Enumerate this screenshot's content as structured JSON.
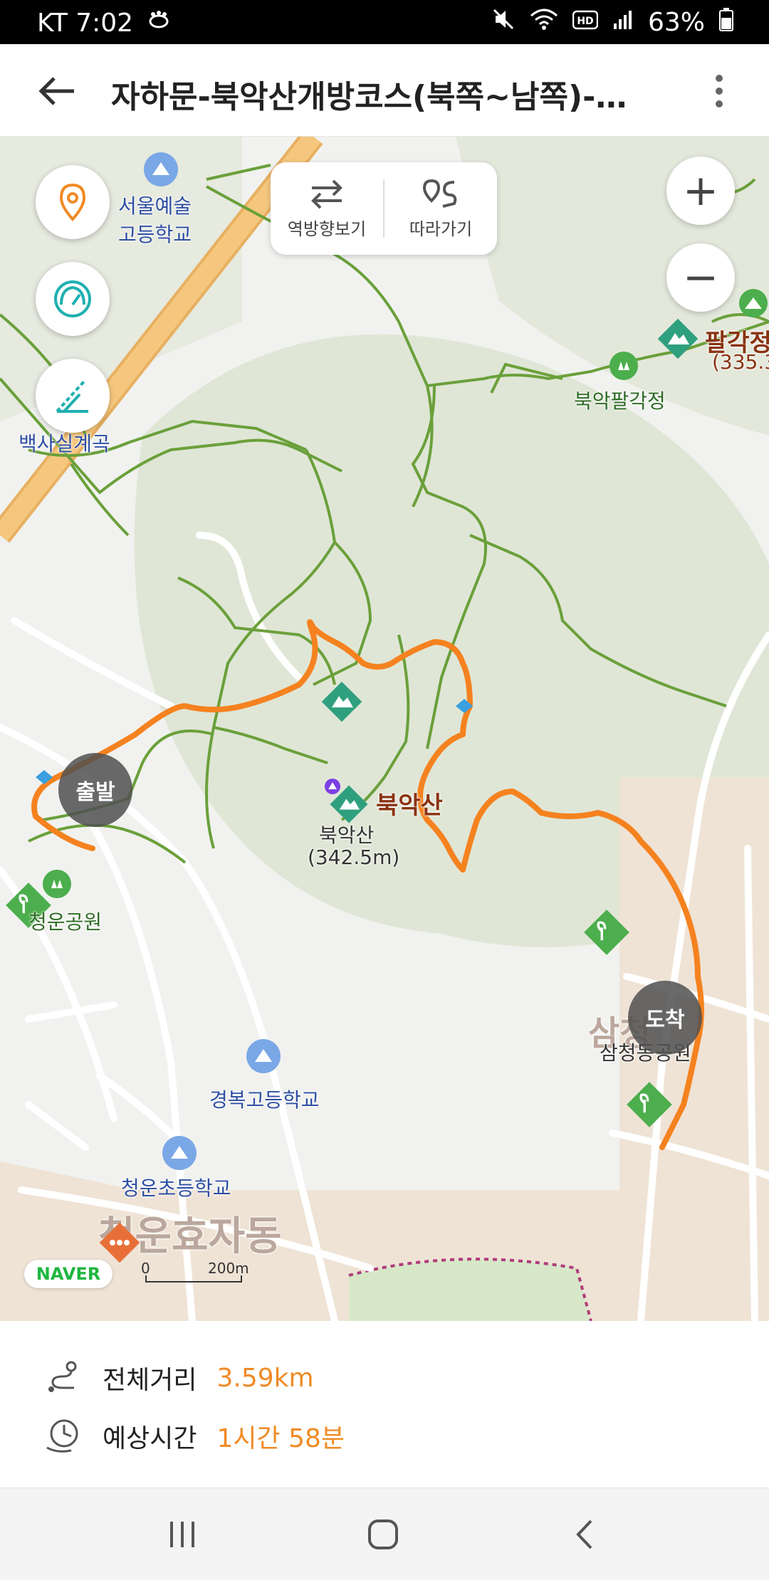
{
  "status_bar": {
    "carrier_time": "KT 7:02",
    "battery": "63%",
    "icons": [
      "footprint-icon",
      "mute-icon",
      "wifi-icon",
      "hd-icon",
      "signal-icon",
      "battery-icon"
    ]
  },
  "app_bar": {
    "title": "자하문-북악산개방코스(북쪽~남쪽)-삼청…"
  },
  "map_controls": {
    "reverse_label": "역방향보기",
    "follow_label": "따라가기",
    "zoom_in": "+",
    "zoom_out": "−"
  },
  "map_labels": {
    "seoul_arts_hs": "서울예술\n고등학교",
    "baeksasil": "백사실계곡",
    "bugak_palgakjeong": "북악팔각정",
    "palgakjeong_peak": "팔각정",
    "palgakjeong_height": "(335.3",
    "bugaksan_peak": "북악산",
    "bugaksan_name": "북악산",
    "bugaksan_height": "(342.5m)",
    "cheongun_park": "청운공원",
    "gyeongbok_hs": "경복고등학교",
    "cheongun_es": "청운초등학교",
    "cheongun_dong": "청운효자동",
    "samcheong_park": "삼청동공원",
    "samcheong_partial": "삼청"
  },
  "markers": {
    "start": "출발",
    "end": "도착"
  },
  "map_footer": {
    "logo": "NAVER",
    "scale_zero": "0",
    "scale_end": "200m"
  },
  "route_info": {
    "distance_label": "전체거리",
    "distance_value": "3.59km",
    "time_label": "예상시간",
    "time_value": "1시간 58분"
  },
  "colors": {
    "route": "#f5821f",
    "trail": "#6aa03a",
    "accent": "#f08a24"
  }
}
